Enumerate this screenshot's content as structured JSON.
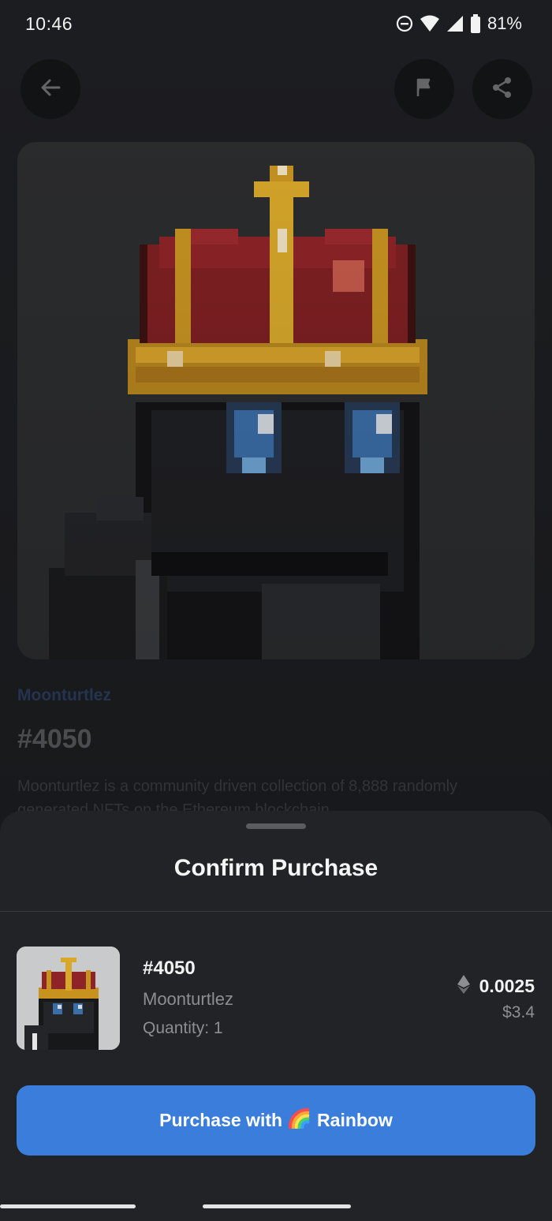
{
  "status_bar": {
    "time": "10:46",
    "battery": "81%",
    "icons": [
      "do-not-disturb-icon",
      "wifi-icon",
      "signal-icon",
      "battery-icon"
    ]
  },
  "header": {
    "icons": [
      "back-arrow-icon",
      "flag-icon",
      "share-icon"
    ]
  },
  "nft": {
    "collection": "Moonturtlez",
    "title": "#4050",
    "description": "Moonturtlez is a community driven collection of 8,888 randomly generated NFTs on the Ethereum blockchain"
  },
  "sheet": {
    "title": "Confirm Purchase",
    "item": {
      "name": "#4050",
      "collection": "Moonturtlez",
      "quantity": "Quantity: 1",
      "price_eth": "0.0025",
      "price_usd": "$3.4"
    },
    "button": {
      "prefix": "Purchase with",
      "suffix": "Rainbow"
    }
  },
  "colors": {
    "accent": "#3b7ddb",
    "sheet_bg": "#222326",
    "page_bg": "#1c1d20"
  }
}
